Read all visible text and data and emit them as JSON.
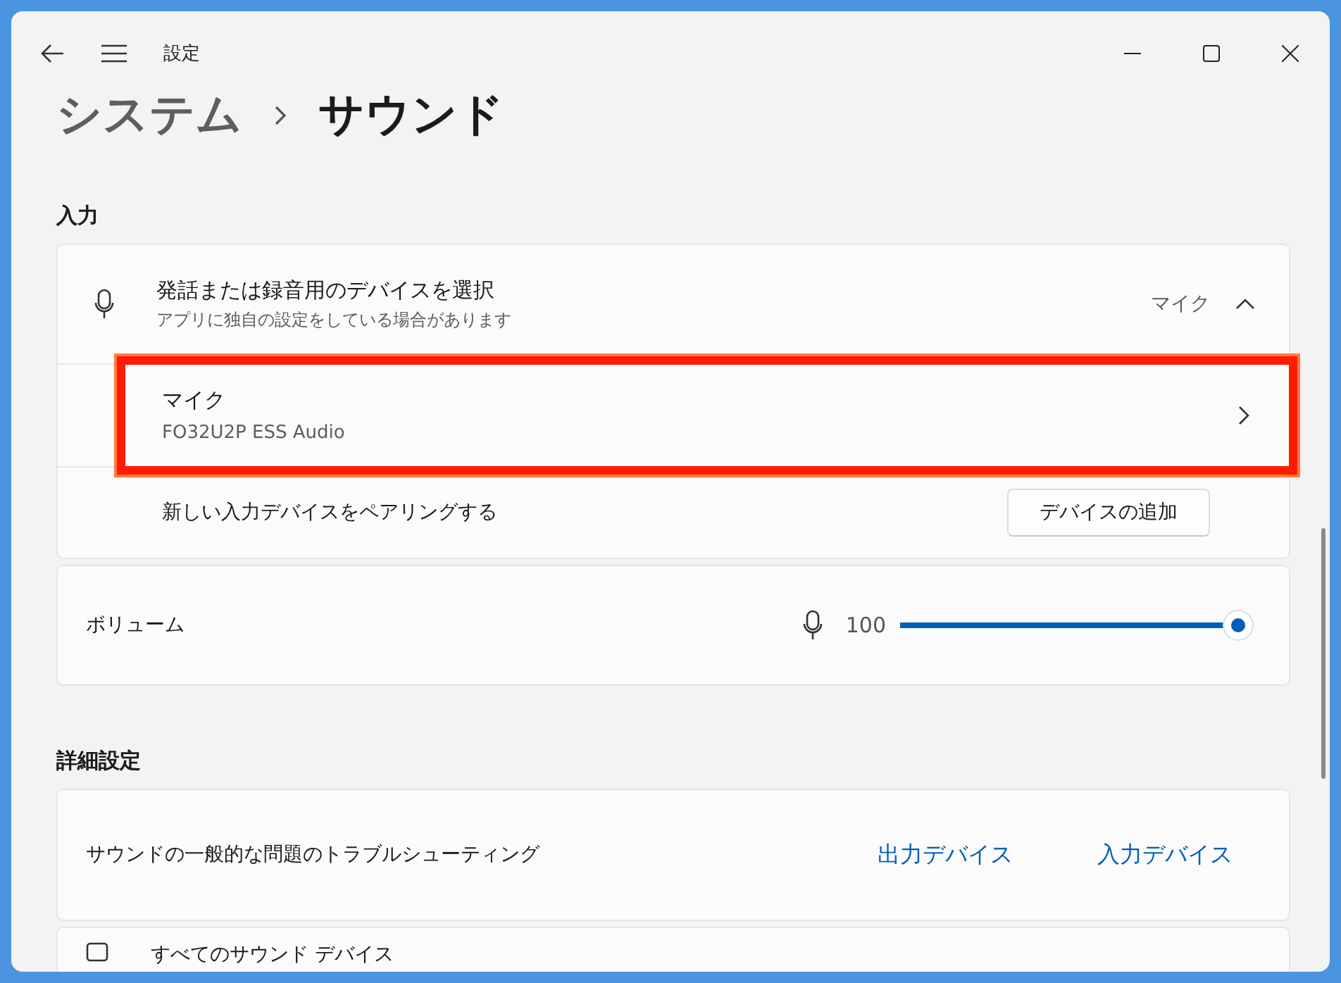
{
  "window": {
    "title": "設定"
  },
  "breadcrumb": {
    "parent": "システム",
    "current": "サウンド"
  },
  "input_section": {
    "heading": "入力",
    "device_picker": {
      "title": "発話または録音用のデバイスを選択",
      "subtitle": "アプリに独自の設定をしている場合があります",
      "value": "マイク",
      "expanded": true
    },
    "devices": [
      {
        "name": "マイク",
        "detail": "FO32U2P ESS Audio",
        "highlighted": true
      }
    ],
    "pair_row": {
      "label": "新しい入力デバイスをペアリングする",
      "button": "デバイスの追加"
    },
    "volume": {
      "label": "ボリューム",
      "reading": "100",
      "level": 1.0
    }
  },
  "advanced_section": {
    "heading": "詳細設定",
    "troubleshoot": {
      "label": "サウンドの一般的な問題のトラブルシューティング",
      "links": [
        "出力デバイス",
        "入力デバイス"
      ]
    },
    "all_devices": {
      "label": "すべてのサウンド デバイス"
    }
  }
}
